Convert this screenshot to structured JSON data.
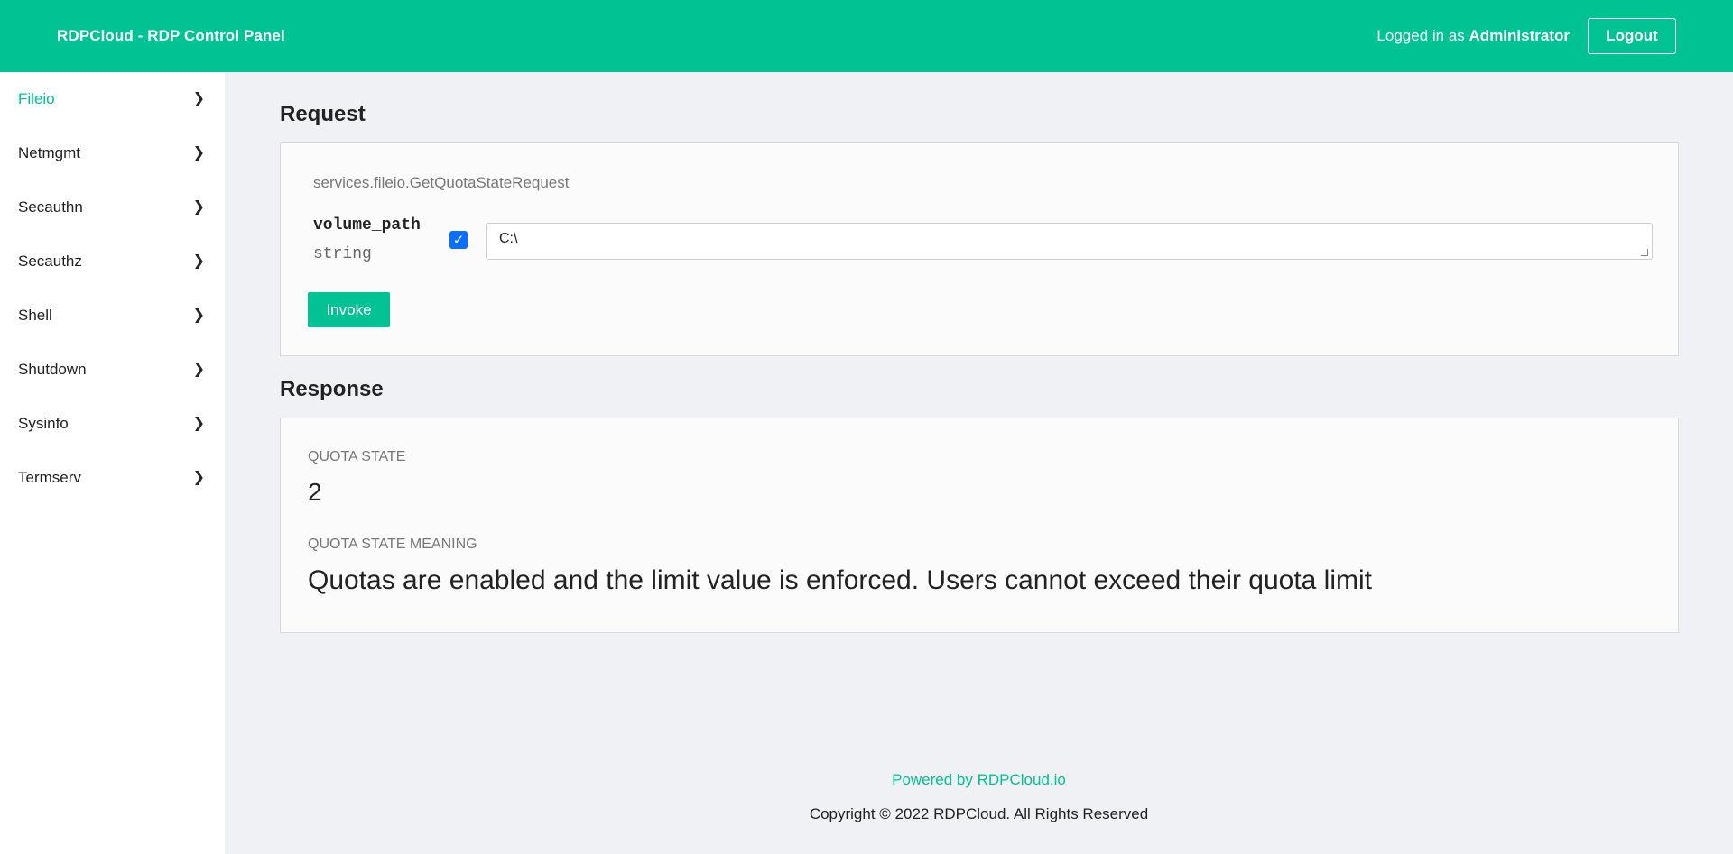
{
  "header": {
    "brand": "RDPCloud - RDP Control Panel",
    "login_prefix": "Logged in as",
    "username": "Administrator",
    "logout_label": "Logout"
  },
  "sidebar": {
    "items": [
      {
        "label": "Fileio",
        "active": true
      },
      {
        "label": "Netmgmt",
        "active": false
      },
      {
        "label": "Secauthn",
        "active": false
      },
      {
        "label": "Secauthz",
        "active": false
      },
      {
        "label": "Shell",
        "active": false
      },
      {
        "label": "Shutdown",
        "active": false
      },
      {
        "label": "Sysinfo",
        "active": false
      },
      {
        "label": "Termserv",
        "active": false
      }
    ],
    "chevron_icon": "chevron-right-icon"
  },
  "request": {
    "title": "Request",
    "type_name": "services.fileio.GetQuotaStateRequest",
    "field": {
      "name": "volume_path",
      "type": "string",
      "enabled": true,
      "value": "C:\\"
    },
    "invoke_label": "Invoke"
  },
  "response": {
    "title": "Response",
    "quota_state_label": "QUOTA STATE",
    "quota_state_value": "2",
    "quota_meaning_label": "QUOTA STATE MEANING",
    "quota_meaning_value": "Quotas are enabled and the limit value is enforced. Users cannot exceed their quota limit"
  },
  "footer": {
    "powered_by": "Powered by RDPCloud.io",
    "copyright": "Copyright © 2022 RDPCloud. All Rights Reserved"
  },
  "colors": {
    "accent": "#00c292",
    "checkbox": "#0b6efd",
    "background": "#f0f1f4"
  }
}
